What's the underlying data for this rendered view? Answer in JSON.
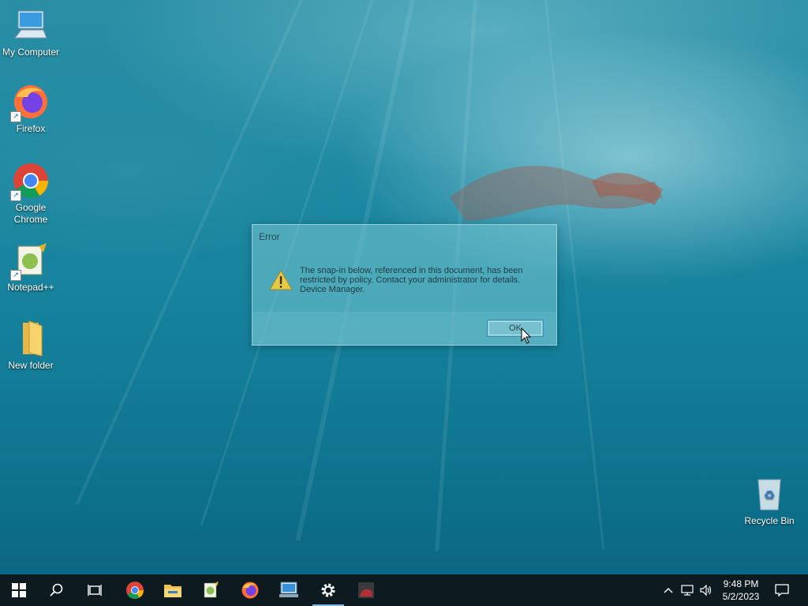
{
  "desktop": {
    "icons": [
      {
        "label": "My Computer",
        "icon": "computer-icon"
      },
      {
        "label": "Firefox",
        "icon": "firefox-icon"
      },
      {
        "label": "Google Chrome",
        "icon": "chrome-icon"
      },
      {
        "label": "Notepad++",
        "icon": "notepadpp-icon"
      },
      {
        "label": "New folder",
        "icon": "folder-icon"
      },
      {
        "label": "Recycle Bin",
        "icon": "recycle-bin-icon"
      }
    ]
  },
  "dialog": {
    "title": "Error",
    "message_line1": "The snap-in below, referenced in this document, has been",
    "message_line2": "restricted by policy. Contact your administrator for details.",
    "message_line3": "Device Manager.",
    "ok_label": "OK",
    "icon": "warning-icon"
  },
  "taskbar": {
    "items": [
      "start-icon",
      "search-icon",
      "task-view-icon",
      "chrome-icon",
      "file-explorer-icon",
      "notepadpp-icon",
      "firefox-icon",
      "remote-desktop-icon",
      "settings-icon",
      "app-icon"
    ],
    "active_item": "settings-icon",
    "clock_time": "9:48 PM",
    "clock_date": "5/2/2023",
    "tray_icons": [
      "chevron-up-icon",
      "network-icon",
      "volume-icon",
      "notification-icon"
    ]
  },
  "colors": {
    "taskbar_bg": "#0d1a1f",
    "accent": "#76b9ed",
    "dialog_tint": "#78c8d2"
  }
}
